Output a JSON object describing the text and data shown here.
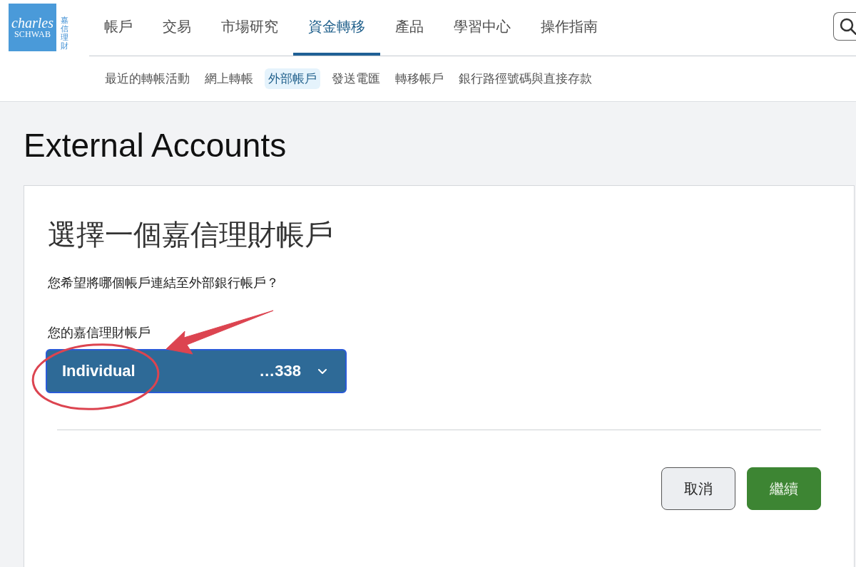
{
  "logo": {
    "wordmark_top": "charles",
    "wordmark_bottom": "SCHWAB",
    "vertical_text": "嘉信理財"
  },
  "main_nav": [
    {
      "label": "帳戶",
      "selected": false
    },
    {
      "label": "交易",
      "selected": false
    },
    {
      "label": "市場研究",
      "selected": false
    },
    {
      "label": "資金轉移",
      "selected": true
    },
    {
      "label": "產品",
      "selected": false
    },
    {
      "label": "學習中心",
      "selected": false
    },
    {
      "label": "操作指南",
      "selected": false
    }
  ],
  "sub_nav": [
    {
      "label": "最近的轉帳活動",
      "selected": false
    },
    {
      "label": "網上轉帳",
      "selected": false
    },
    {
      "label": "外部帳戶",
      "selected": true
    },
    {
      "label": "發送電匯",
      "selected": false
    },
    {
      "label": "轉移帳戶",
      "selected": false
    },
    {
      "label": "銀行路徑號碼與直接存款",
      "selected": false
    }
  ],
  "page_title": "External Accounts",
  "card": {
    "heading": "選擇一個嘉信理財帳戶",
    "question": "您希望將哪個帳戶連結至外部銀行帳戶？",
    "account_select": {
      "label": "您的嘉信理財帳戶",
      "account_type": "Individual",
      "account_number": "…338",
      "annotation": {
        "circled": true,
        "arrow": true
      }
    },
    "buttons": [
      {
        "label": "取消",
        "kind": "secondary"
      },
      {
        "label": "繼續",
        "kind": "primary"
      }
    ]
  }
}
